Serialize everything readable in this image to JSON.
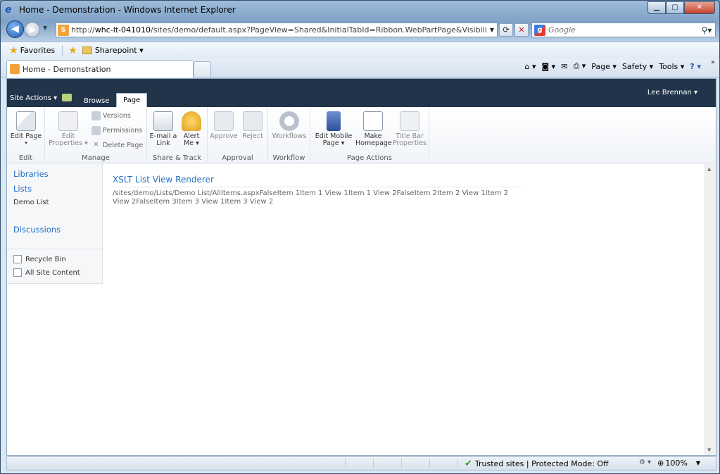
{
  "window": {
    "title": "Home - Demonstration - Windows Internet Explorer"
  },
  "address": {
    "url_prefix": "http://",
    "url_host": "whc-lt-041010",
    "url_rest": "/sites/demo/default.aspx?PageView=Shared&InitialTabId=Ribbon.WebPartPage&VisibilityContext=WSSW"
  },
  "search": {
    "placeholder": "Google"
  },
  "favorites": {
    "favorites_label": "Favorites",
    "sharepoint_label": "Sharepoint ▾"
  },
  "tab": {
    "title": "Home - Demonstration"
  },
  "commandbar": {
    "page": "Page ▾",
    "safety": "Safety ▾",
    "tools": "Tools ▾"
  },
  "sp": {
    "site_actions": "Site Actions ▾",
    "tabs": [
      "Browse",
      "Page"
    ],
    "user": "Lee Brennan ▾"
  },
  "ribbon": {
    "groups": [
      {
        "label": "Edit"
      },
      {
        "label": "Manage"
      },
      {
        "label": "Share & Track"
      },
      {
        "label": "Approval"
      },
      {
        "label": "Workflow"
      },
      {
        "label": "Page Actions"
      }
    ],
    "edit_page": "Edit Page",
    "edit_properties": "Edit Properties ▾",
    "versions": "Versions",
    "permissions": "Permissions",
    "delete_page": "Delete Page",
    "email_link": "E-mail a Link",
    "alert_me": "Alert Me ▾",
    "approve": "Approve",
    "reject": "Reject",
    "workflows": "Workflows",
    "edit_mobile": "Edit Mobile Page ▾",
    "make_homepage": "Make Homepage",
    "title_bar_properties": "Title Bar Properties"
  },
  "leftnav": {
    "libraries": "Libraries",
    "lists": "Lists",
    "demo_list": "Demo List",
    "discussions": "Discussions",
    "recycle_bin": "Recycle Bin",
    "all_site_content": "All Site Content"
  },
  "webpart": {
    "title": "XSLT List View Renderer",
    "body": "/sites/demo/Lists/Demo List/AllItems.aspxFalseItem 1Item 1 View 1Item 1 View 2FalseItem 2Item 2 View 1Item 2 View 2FalseItem 3Item 3 View 1Item 3 View 2"
  },
  "status": {
    "zone": "Trusted sites | Protected Mode: Off",
    "zoom": "100%"
  }
}
